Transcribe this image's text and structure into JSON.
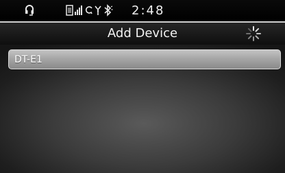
{
  "status_bar": {
    "clock": "2:48",
    "icons": [
      "headset-icon",
      "phone-signal-icon",
      "ring-icon",
      "reception-icon",
      "bluetooth-icon"
    ]
  },
  "header": {
    "title": "Add Device",
    "spinner_icon": "loading-spinner-icon"
  },
  "devices": [
    {
      "label": "DT-E1"
    }
  ],
  "colors": {
    "background": "#000000",
    "row": "#a6a6a6",
    "text": "#ffffff"
  }
}
